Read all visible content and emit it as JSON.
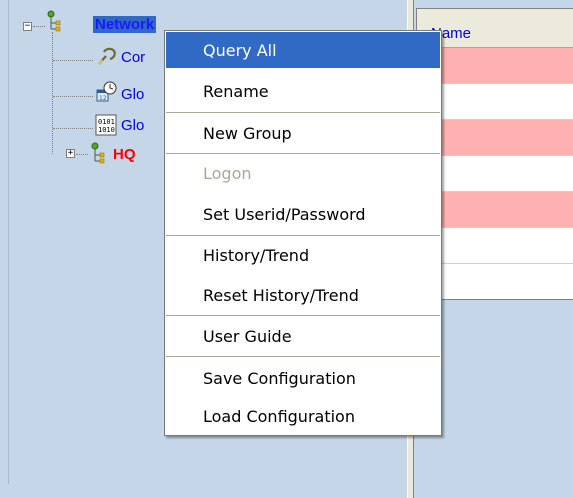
{
  "tree": {
    "items": [
      {
        "label": "Network",
        "icon": "network-root-icon",
        "expander": "−"
      },
      {
        "label": "Cor",
        "icon": "connection-icon"
      },
      {
        "label": "Glo",
        "icon": "clock-calendar-icon"
      },
      {
        "label": "Glo",
        "icon": "binary-data-icon"
      },
      {
        "label": "HQ",
        "icon": "network-node-icon",
        "expander": "+"
      }
    ]
  },
  "grid": {
    "header": "Name",
    "row_colors": [
      "#ffb1b1",
      "#ffffff",
      "#ffb1b1",
      "#ffffff",
      "#ffb1b1",
      "#ffffff"
    ]
  },
  "context_menu": {
    "items": [
      {
        "label": "Query All",
        "state": "highlighted"
      },
      {
        "label": "Rename"
      },
      {
        "label": "New Group"
      },
      {
        "label": "Logon",
        "state": "disabled"
      },
      {
        "label": "Set Userid/Password"
      },
      {
        "label": "History/Trend"
      },
      {
        "label": "Reset History/Trend"
      },
      {
        "label": "User Guide"
      },
      {
        "label": "Save Configuration"
      },
      {
        "label": "Load Configuration"
      }
    ]
  },
  "colors": {
    "panel_bg": "#c4d6e8",
    "menu_highlight": "#316ac5",
    "pink_row": "#ffb1b1",
    "link_blue": "#0000ee",
    "alert_red": "#ff0000"
  }
}
